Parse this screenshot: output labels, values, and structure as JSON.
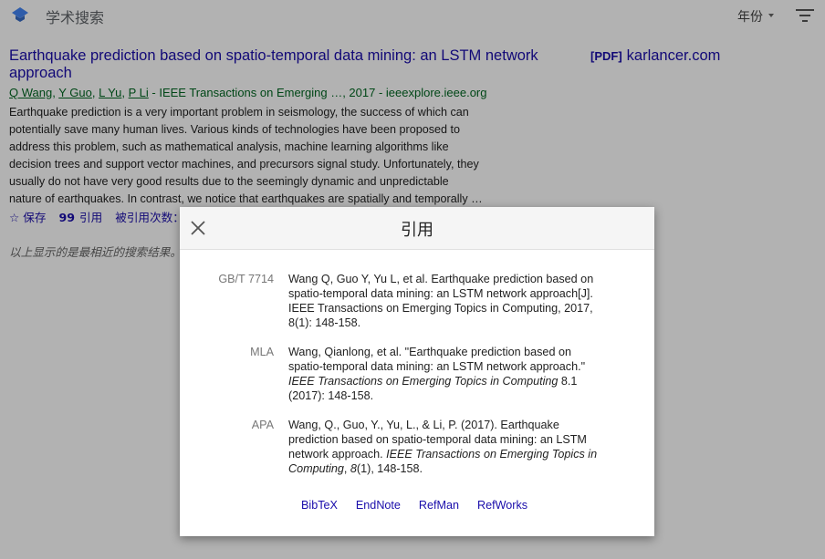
{
  "header": {
    "app_title": "学术搜索",
    "year_filter_label": "年份",
    "icons": {
      "logo": "scholar-cap-icon",
      "filter": "filter-lines-icon",
      "caret": "caret-down-icon"
    }
  },
  "result": {
    "title_line1": "Earthquake prediction based on spatio-temporal data mining: an LSTM network",
    "title_line2": "approach",
    "authors": [
      "Q Wang",
      "Y Guo",
      "L Yu",
      "P Li"
    ],
    "author_separator": ", ",
    "source": " - IEEE Transactions on Emerging …, 2017 - ieeexplore.ieee.org",
    "snippet_lines": [
      "Earthquake prediction is a very important problem in seismology, the success of which can",
      "potentially save many human lives. Various kinds of technologies have been proposed to",
      "address this problem, such as mathematical analysis, machine learning algorithms like",
      "decision trees and support vector machines, and precursors signal study. Unfortunately, they",
      "usually do not have very good results due to the seemingly dynamic and unpredictable",
      "nature of earthquakes. In contrast, we notice that earthquakes are spatially and temporally …"
    ],
    "actions": {
      "save": "保存",
      "cite": "引用",
      "cited_by": "被引用次数："
    },
    "pdf_tag": "[PDF]",
    "pdf_domain": "karlancer.com"
  },
  "note": "以上显示的是最相近的搜索结果。",
  "dialog": {
    "title": "引用",
    "citations": [
      {
        "label": "GB/T 7714",
        "lines": [
          "Wang Q, Guo Y, Yu L, et al. Earthquake prediction based on",
          "spatio-temporal data mining: an LSTM network approach[J].",
          "IEEE Transactions on Emerging Topics in Computing, 2017,",
          "8(1): 148-158."
        ]
      },
      {
        "label": "MLA",
        "line1": "Wang, Qianlong, et al. \"Earthquake prediction based on",
        "line2": "spatio-temporal data mining: an LSTM network approach.\"",
        "line3_italic": "IEEE Transactions on Emerging Topics in Computing",
        "line3_rest": " 8.1",
        "line4": "(2017): 148-158."
      },
      {
        "label": "APA",
        "line1": "Wang, Q., Guo, Y., Yu, L., & Li, P. (2017). Earthquake",
        "line2": "prediction based on spatio-temporal data mining: an LSTM",
        "line3_plain": "network approach. ",
        "line3_italic": "IEEE Transactions on Emerging Topics in",
        "line4_italic": "Computing",
        "line4_mid": ", ",
        "line4_italic2": "8",
        "line4_rest": "(1), 148-158."
      }
    ],
    "exports": [
      "BibTeX",
      "EndNote",
      "RefMan",
      "RefWorks"
    ]
  },
  "colors": {
    "link": "#1a0dab",
    "source_green": "#006621",
    "overlay": "rgba(0,0,0,0.30)"
  }
}
